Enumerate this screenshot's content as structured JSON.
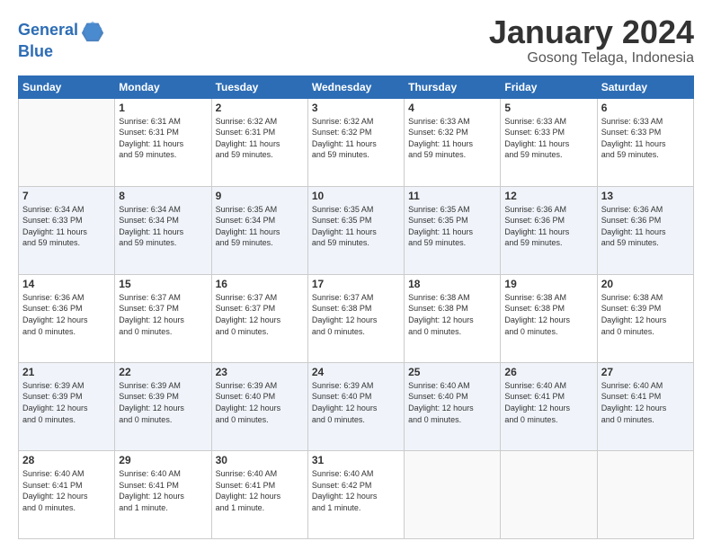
{
  "logo": {
    "line1": "General",
    "line2": "Blue"
  },
  "title": "January 2024",
  "subtitle": "Gosong Telaga, Indonesia",
  "weekdays": [
    "Sunday",
    "Monday",
    "Tuesday",
    "Wednesday",
    "Thursday",
    "Friday",
    "Saturday"
  ],
  "rows": [
    [
      {
        "day": "",
        "info": ""
      },
      {
        "day": "1",
        "info": "Sunrise: 6:31 AM\nSunset: 6:31 PM\nDaylight: 11 hours\nand 59 minutes."
      },
      {
        "day": "2",
        "info": "Sunrise: 6:32 AM\nSunset: 6:31 PM\nDaylight: 11 hours\nand 59 minutes."
      },
      {
        "day": "3",
        "info": "Sunrise: 6:32 AM\nSunset: 6:32 PM\nDaylight: 11 hours\nand 59 minutes."
      },
      {
        "day": "4",
        "info": "Sunrise: 6:33 AM\nSunset: 6:32 PM\nDaylight: 11 hours\nand 59 minutes."
      },
      {
        "day": "5",
        "info": "Sunrise: 6:33 AM\nSunset: 6:33 PM\nDaylight: 11 hours\nand 59 minutes."
      },
      {
        "day": "6",
        "info": "Sunrise: 6:33 AM\nSunset: 6:33 PM\nDaylight: 11 hours\nand 59 minutes."
      }
    ],
    [
      {
        "day": "7",
        "info": "Sunrise: 6:34 AM\nSunset: 6:33 PM\nDaylight: 11 hours\nand 59 minutes."
      },
      {
        "day": "8",
        "info": "Sunrise: 6:34 AM\nSunset: 6:34 PM\nDaylight: 11 hours\nand 59 minutes."
      },
      {
        "day": "9",
        "info": "Sunrise: 6:35 AM\nSunset: 6:34 PM\nDaylight: 11 hours\nand 59 minutes."
      },
      {
        "day": "10",
        "info": "Sunrise: 6:35 AM\nSunset: 6:35 PM\nDaylight: 11 hours\nand 59 minutes."
      },
      {
        "day": "11",
        "info": "Sunrise: 6:35 AM\nSunset: 6:35 PM\nDaylight: 11 hours\nand 59 minutes."
      },
      {
        "day": "12",
        "info": "Sunrise: 6:36 AM\nSunset: 6:36 PM\nDaylight: 11 hours\nand 59 minutes."
      },
      {
        "day": "13",
        "info": "Sunrise: 6:36 AM\nSunset: 6:36 PM\nDaylight: 11 hours\nand 59 minutes."
      }
    ],
    [
      {
        "day": "14",
        "info": "Sunrise: 6:36 AM\nSunset: 6:36 PM\nDaylight: 12 hours\nand 0 minutes."
      },
      {
        "day": "15",
        "info": "Sunrise: 6:37 AM\nSunset: 6:37 PM\nDaylight: 12 hours\nand 0 minutes."
      },
      {
        "day": "16",
        "info": "Sunrise: 6:37 AM\nSunset: 6:37 PM\nDaylight: 12 hours\nand 0 minutes."
      },
      {
        "day": "17",
        "info": "Sunrise: 6:37 AM\nSunset: 6:38 PM\nDaylight: 12 hours\nand 0 minutes."
      },
      {
        "day": "18",
        "info": "Sunrise: 6:38 AM\nSunset: 6:38 PM\nDaylight: 12 hours\nand 0 minutes."
      },
      {
        "day": "19",
        "info": "Sunrise: 6:38 AM\nSunset: 6:38 PM\nDaylight: 12 hours\nand 0 minutes."
      },
      {
        "day": "20",
        "info": "Sunrise: 6:38 AM\nSunset: 6:39 PM\nDaylight: 12 hours\nand 0 minutes."
      }
    ],
    [
      {
        "day": "21",
        "info": "Sunrise: 6:39 AM\nSunset: 6:39 PM\nDaylight: 12 hours\nand 0 minutes."
      },
      {
        "day": "22",
        "info": "Sunrise: 6:39 AM\nSunset: 6:39 PM\nDaylight: 12 hours\nand 0 minutes."
      },
      {
        "day": "23",
        "info": "Sunrise: 6:39 AM\nSunset: 6:40 PM\nDaylight: 12 hours\nand 0 minutes."
      },
      {
        "day": "24",
        "info": "Sunrise: 6:39 AM\nSunset: 6:40 PM\nDaylight: 12 hours\nand 0 minutes."
      },
      {
        "day": "25",
        "info": "Sunrise: 6:40 AM\nSunset: 6:40 PM\nDaylight: 12 hours\nand 0 minutes."
      },
      {
        "day": "26",
        "info": "Sunrise: 6:40 AM\nSunset: 6:41 PM\nDaylight: 12 hours\nand 0 minutes."
      },
      {
        "day": "27",
        "info": "Sunrise: 6:40 AM\nSunset: 6:41 PM\nDaylight: 12 hours\nand 0 minutes."
      }
    ],
    [
      {
        "day": "28",
        "info": "Sunrise: 6:40 AM\nSunset: 6:41 PM\nDaylight: 12 hours\nand 0 minutes."
      },
      {
        "day": "29",
        "info": "Sunrise: 6:40 AM\nSunset: 6:41 PM\nDaylight: 12 hours\nand 1 minute."
      },
      {
        "day": "30",
        "info": "Sunrise: 6:40 AM\nSunset: 6:41 PM\nDaylight: 12 hours\nand 1 minute."
      },
      {
        "day": "31",
        "info": "Sunrise: 6:40 AM\nSunset: 6:42 PM\nDaylight: 12 hours\nand 1 minute."
      },
      {
        "day": "",
        "info": ""
      },
      {
        "day": "",
        "info": ""
      },
      {
        "day": "",
        "info": ""
      }
    ]
  ]
}
